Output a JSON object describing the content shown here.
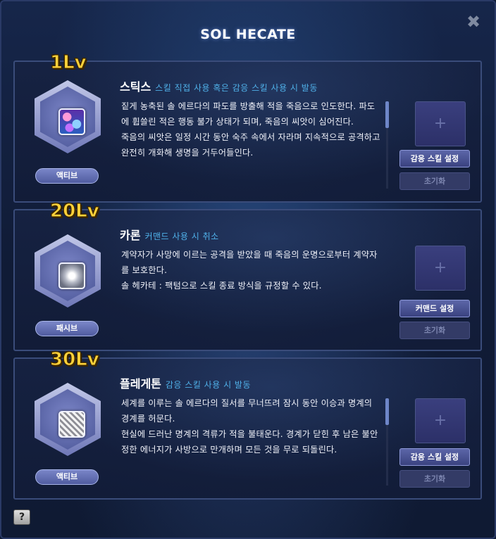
{
  "window": {
    "title": "SOL HECATE",
    "close_icon": "✖",
    "help_label": "?"
  },
  "skills": [
    {
      "level": "1Lv",
      "name": "스틱스",
      "condition": "스킬 직접 사용 혹은 감응 스킬 사용 시 발동",
      "description": "짙게 농축된 솔 에르다의 파도를 방출해 적을 죽음으로 인도한다. 파도에 휩쓸린 적은 행동 불가 상태가 되며, 죽음의 씨앗이 심어진다.\n죽음의 씨앗은 일정 시간 동안 숙주 속에서 자라며 지속적으로 공격하고 완전히 개화해 생명을 거두어들인다.",
      "type": "액티브",
      "icon": "styx-skill-icon",
      "slot_icon": "+",
      "set_label": "감응 스킬 설정",
      "reset_label": "초기화"
    },
    {
      "level": "20Lv",
      "name": "카론",
      "condition": "커맨드 사용 시 취소",
      "description": "계약자가 사망에 이르는 공격을 받았을 때 죽음의 운명으로부터 계약자를 보호한다.\n솔 헤카테 : 팩텀으로 스킬 종료 방식을 규정할 수 있다.",
      "type": "패시브",
      "icon": "charon-skill-icon",
      "slot_icon": "+",
      "set_label": "커맨드 설정",
      "reset_label": "초기화"
    },
    {
      "level": "30Lv",
      "name": "플레게톤",
      "condition": "감응 스킬 사용 시 발동",
      "description": "세계를 이루는 솔 에르다의 질서를 무너뜨려 잠시 동안 이승과 명계의 경계를 허문다.\n현실에 드러난 명계의 격류가 적을 불태운다. 경계가 닫힌 후 남은 불안정한 에너지가 사방으로 만개하며 모든 것을 무로 되돌린다.",
      "type": "액티브",
      "icon": "phlegethon-skill-icon",
      "slot_icon": "+",
      "set_label": "감응 스킬 설정",
      "reset_label": "초기화"
    }
  ]
}
